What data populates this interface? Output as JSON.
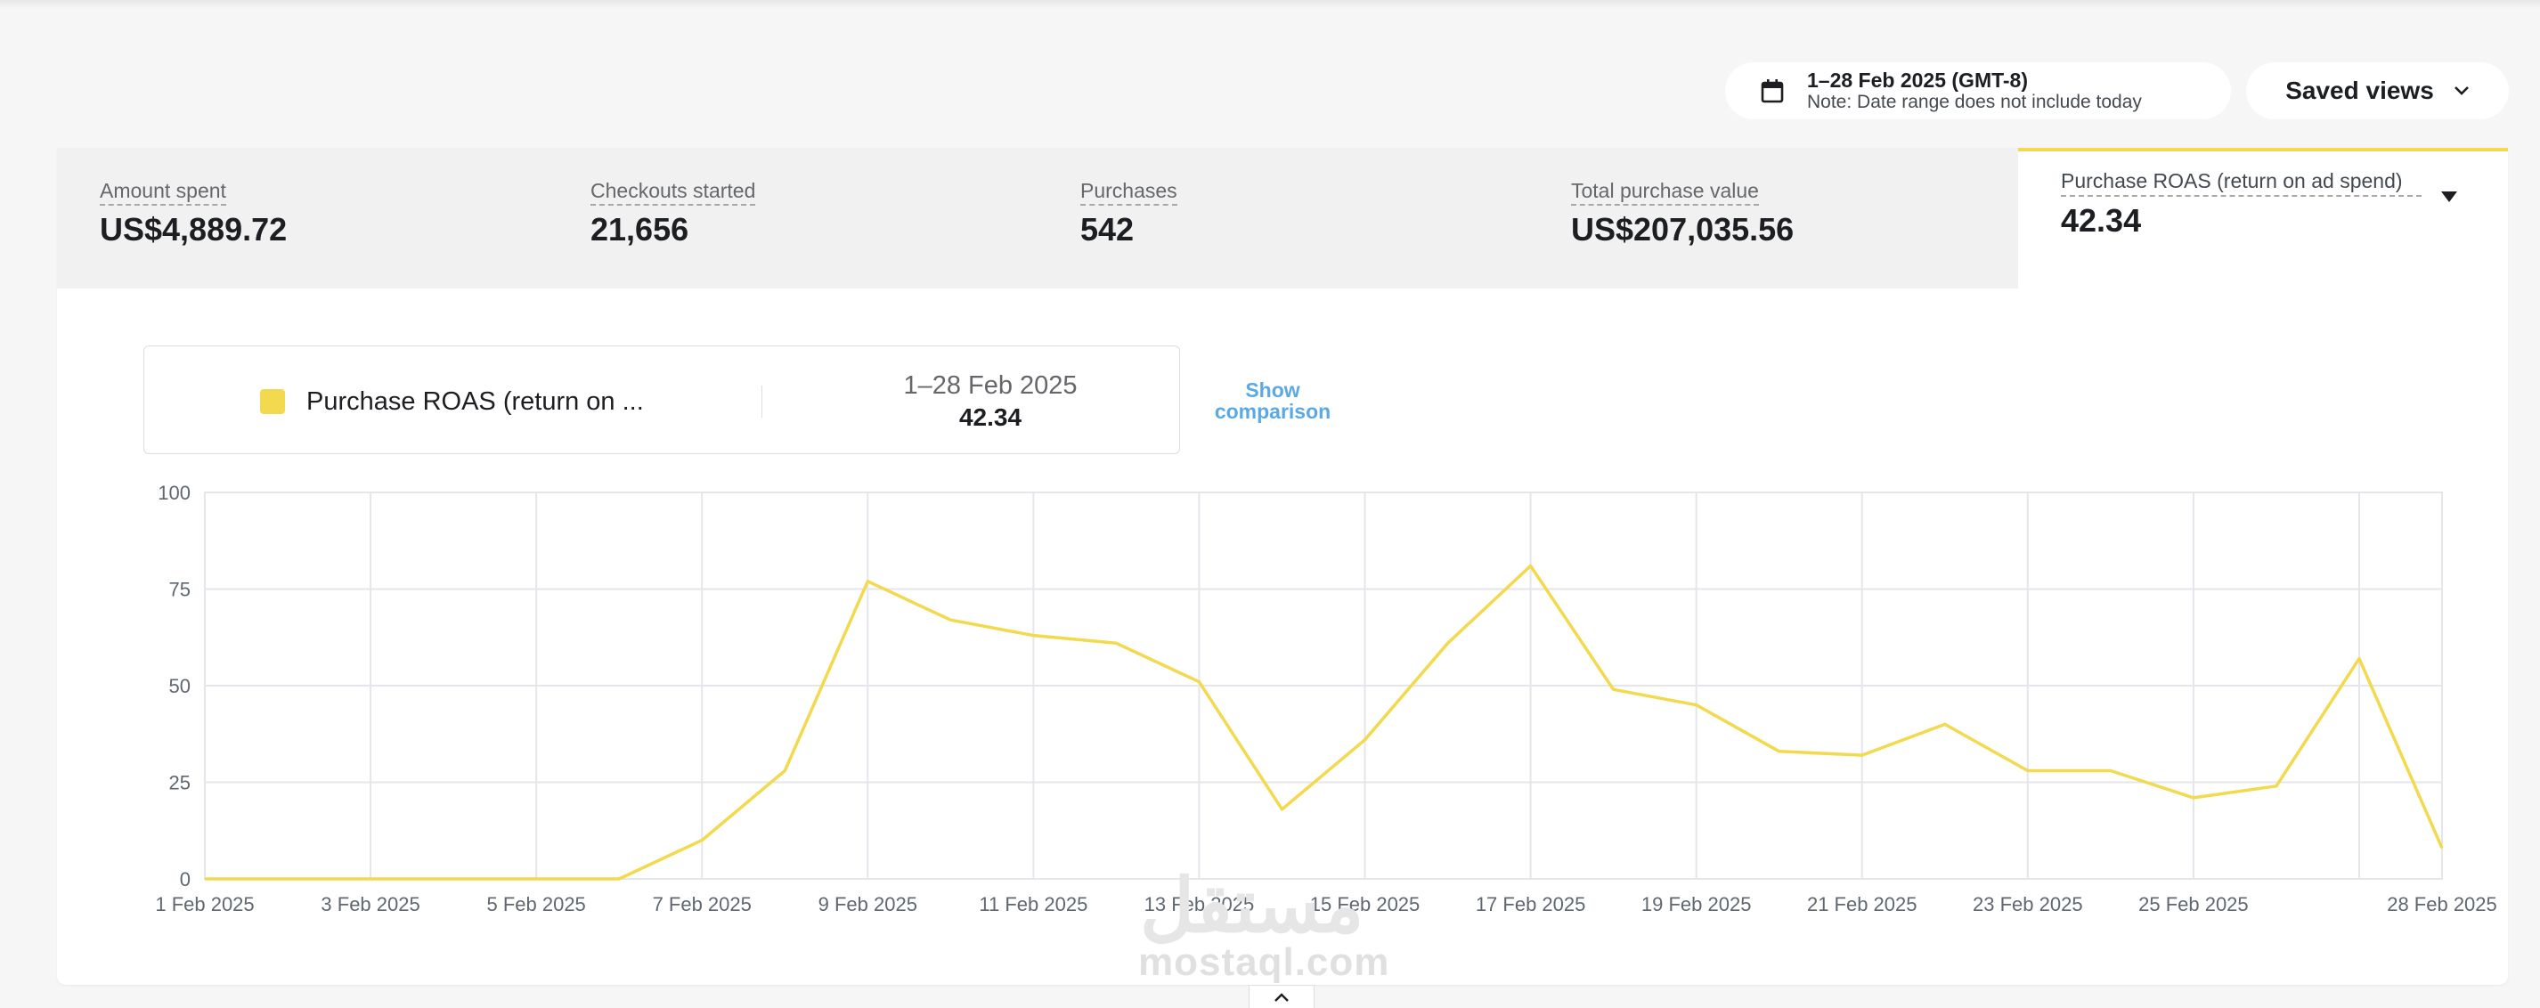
{
  "date_range": {
    "label": "1–28 Feb 2025 (GMT-8)",
    "note": "Note: Date range does not include today"
  },
  "saved_views": {
    "label": "Saved views"
  },
  "metrics": [
    {
      "label": "Amount spent",
      "value": "US$4,889.72"
    },
    {
      "label": "Checkouts started",
      "value": "21,656"
    },
    {
      "label": "Purchases",
      "value": "542"
    },
    {
      "label": "Total purchase value",
      "value": "US$207,035.56"
    },
    {
      "label": "Purchase ROAS (return on ad spend)",
      "value": "42.34",
      "selected": true
    }
  ],
  "legend": {
    "series_name": "Purchase ROAS (return on ...",
    "date": "1–28 Feb 2025",
    "value": "42.34",
    "color": "#f2d94e"
  },
  "show_comparison": "Show comparison",
  "watermark": {
    "main": "مستقل",
    "sub": "mostaql.com"
  },
  "chart_data": {
    "type": "line",
    "ylim": [
      0,
      100
    ],
    "yticks": [
      0,
      25,
      50,
      75,
      100
    ],
    "xtick_labels": [
      "1 Feb 2025",
      "3 Feb 2025",
      "5 Feb 2025",
      "7 Feb 2025",
      "9 Feb 2025",
      "11 Feb 2025",
      "13 Feb 2025",
      "15 Feb 2025",
      "17 Feb 2025",
      "19 Feb 2025",
      "21 Feb 2025",
      "23 Feb 2025",
      "25 Feb 2025",
      "28 Feb 2025"
    ],
    "grid": true,
    "series": [
      {
        "color": "#f2d94e",
        "x": [
          "1 Feb 2025",
          "2 Feb 2025",
          "3 Feb 2025",
          "4 Feb 2025",
          "5 Feb 2025",
          "6 Feb 2025",
          "7 Feb 2025",
          "8 Feb 2025",
          "9 Feb 2025",
          "10 Feb 2025",
          "11 Feb 2025",
          "12 Feb 2025",
          "13 Feb 2025",
          "14 Feb 2025",
          "15 Feb 2025",
          "16 Feb 2025",
          "17 Feb 2025",
          "18 Feb 2025",
          "19 Feb 2025",
          "20 Feb 2025",
          "21 Feb 2025",
          "22 Feb 2025",
          "23 Feb 2025",
          "24 Feb 2025",
          "25 Feb 2025",
          "26 Feb 2025",
          "27 Feb 2025",
          "28 Feb 2025"
        ],
        "values": [
          0,
          0,
          0,
          0,
          0,
          0,
          10,
          28,
          77,
          67,
          63,
          61,
          51,
          18,
          36,
          61,
          81,
          49,
          45,
          33,
          32,
          40,
          28,
          28,
          21,
          24,
          57,
          8
        ]
      }
    ]
  }
}
